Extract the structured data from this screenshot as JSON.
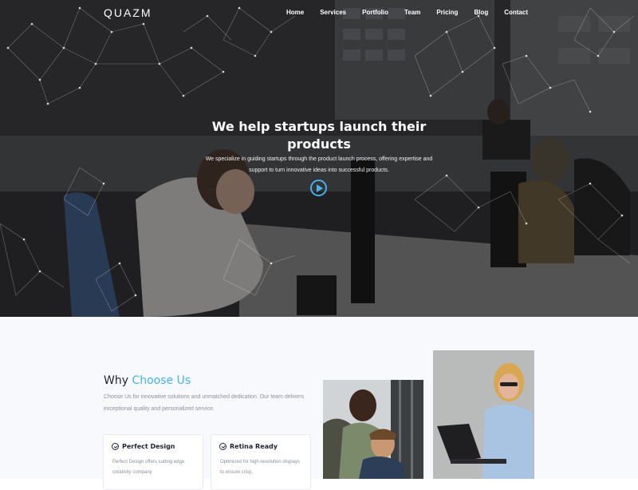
{
  "nav": {
    "logo": "QUAZM",
    "links": [
      "Home",
      "Services",
      "Portfolio",
      "Team",
      "Pricing",
      "Blog",
      "Contact"
    ]
  },
  "hero": {
    "title": "We help startups launch their products",
    "subtitle": "We specialize in guiding startups through the product launch process, offering expertise and support to turn innovative ideas into successful products.",
    "play_icon": "play-icon"
  },
  "why": {
    "title_plain": "Why ",
    "title_accent": "Choose Us",
    "description": "Choose Us for innovative solutions and unmatched dedication. Our team delivers exceptional quality and personalized service.",
    "cards": [
      {
        "title": "Perfect Design",
        "text": "Perfect Design offers cutting edge creativity company"
      },
      {
        "title": "Retina Ready",
        "text": "Optimized for high-resolution displays to ensure crisp."
      }
    ]
  },
  "colors": {
    "accent": "#4ab1e8",
    "dark_text": "#1e2330",
    "muted_text": "#8a8f9c",
    "section_bg": "#f8f9fc"
  }
}
